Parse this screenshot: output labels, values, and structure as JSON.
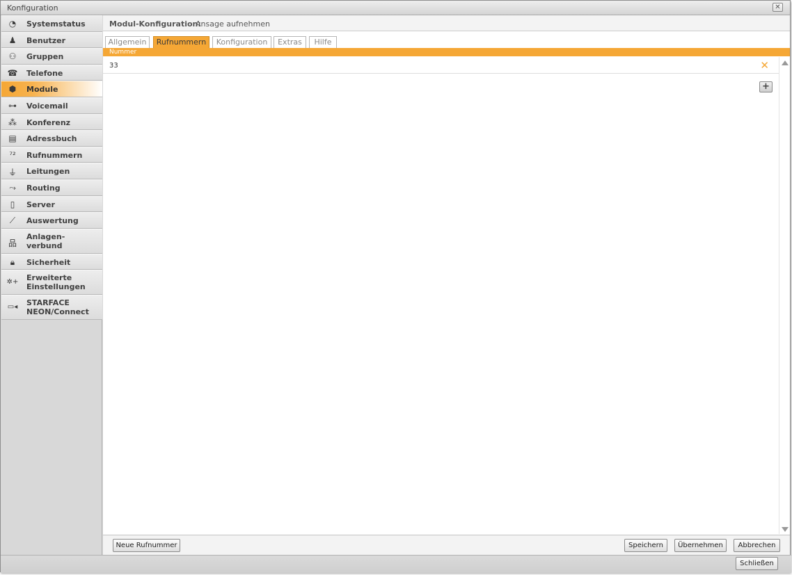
{
  "window": {
    "title": "Konfiguration",
    "close_symbol": "✕"
  },
  "sidebar": {
    "items": [
      {
        "label": "Systemstatus",
        "icon": "system-status-icon",
        "glyph": "◔"
      },
      {
        "label": "Benutzer",
        "icon": "user-icon",
        "glyph": "♟"
      },
      {
        "label": "Gruppen",
        "icon": "group-icon",
        "glyph": "⚇"
      },
      {
        "label": "Telefone",
        "icon": "phone-icon",
        "glyph": "☎"
      },
      {
        "label": "Module",
        "icon": "module-icon",
        "glyph": "⬢"
      },
      {
        "label": "Voicemail",
        "icon": "voicemail-icon",
        "glyph": "⊶"
      },
      {
        "label": "Konferenz",
        "icon": "conference-icon",
        "glyph": "⁂"
      },
      {
        "label": "Adressbuch",
        "icon": "addressbook-icon",
        "glyph": "▤"
      },
      {
        "label": "Rufnummern",
        "icon": "phone-numbers-icon",
        "glyph": "⁷²"
      },
      {
        "label": "Leitungen",
        "icon": "lines-icon",
        "glyph": "⏚"
      },
      {
        "label": "Routing",
        "icon": "routing-icon",
        "glyph": "⤳"
      },
      {
        "label": "Server",
        "icon": "server-icon",
        "glyph": "▯"
      },
      {
        "label": "Auswertung",
        "icon": "chart-icon",
        "glyph": "⟋"
      },
      {
        "label": "Anlagen-",
        "label2": "verbund",
        "icon": "network-icon",
        "glyph": "品"
      },
      {
        "label": "Sicherheit",
        "icon": "lock-icon",
        "glyph": "🔒︎"
      },
      {
        "label": "Erweiterte",
        "label2": "Einstellungen",
        "icon": "advanced-settings-icon",
        "glyph": "✲+"
      },
      {
        "label": "STARFACE",
        "label2": "NEON/Connect",
        "icon": "video-camera-icon",
        "glyph": "▭◂"
      }
    ]
  },
  "module_header": {
    "label": "Modul-Konfiguration:",
    "value": "Ansage aufnehmen"
  },
  "tabs": [
    {
      "label": "Allgemein"
    },
    {
      "label": "Rufnummern"
    },
    {
      "label": "Konfiguration"
    },
    {
      "label": "Extras"
    },
    {
      "label": "Hilfe"
    }
  ],
  "table": {
    "column_header": "Nummer",
    "rows": [
      {
        "value": "33",
        "delete_symbol": "✕"
      }
    ]
  },
  "add_button_symbol": "+",
  "footer": {
    "new_number": "Neue Rufnummer",
    "save": "Speichern",
    "apply": "Übernehmen",
    "cancel": "Abbrechen"
  },
  "bottom": {
    "close": "Schließen"
  },
  "colors": {
    "accent": "#f5a735"
  }
}
